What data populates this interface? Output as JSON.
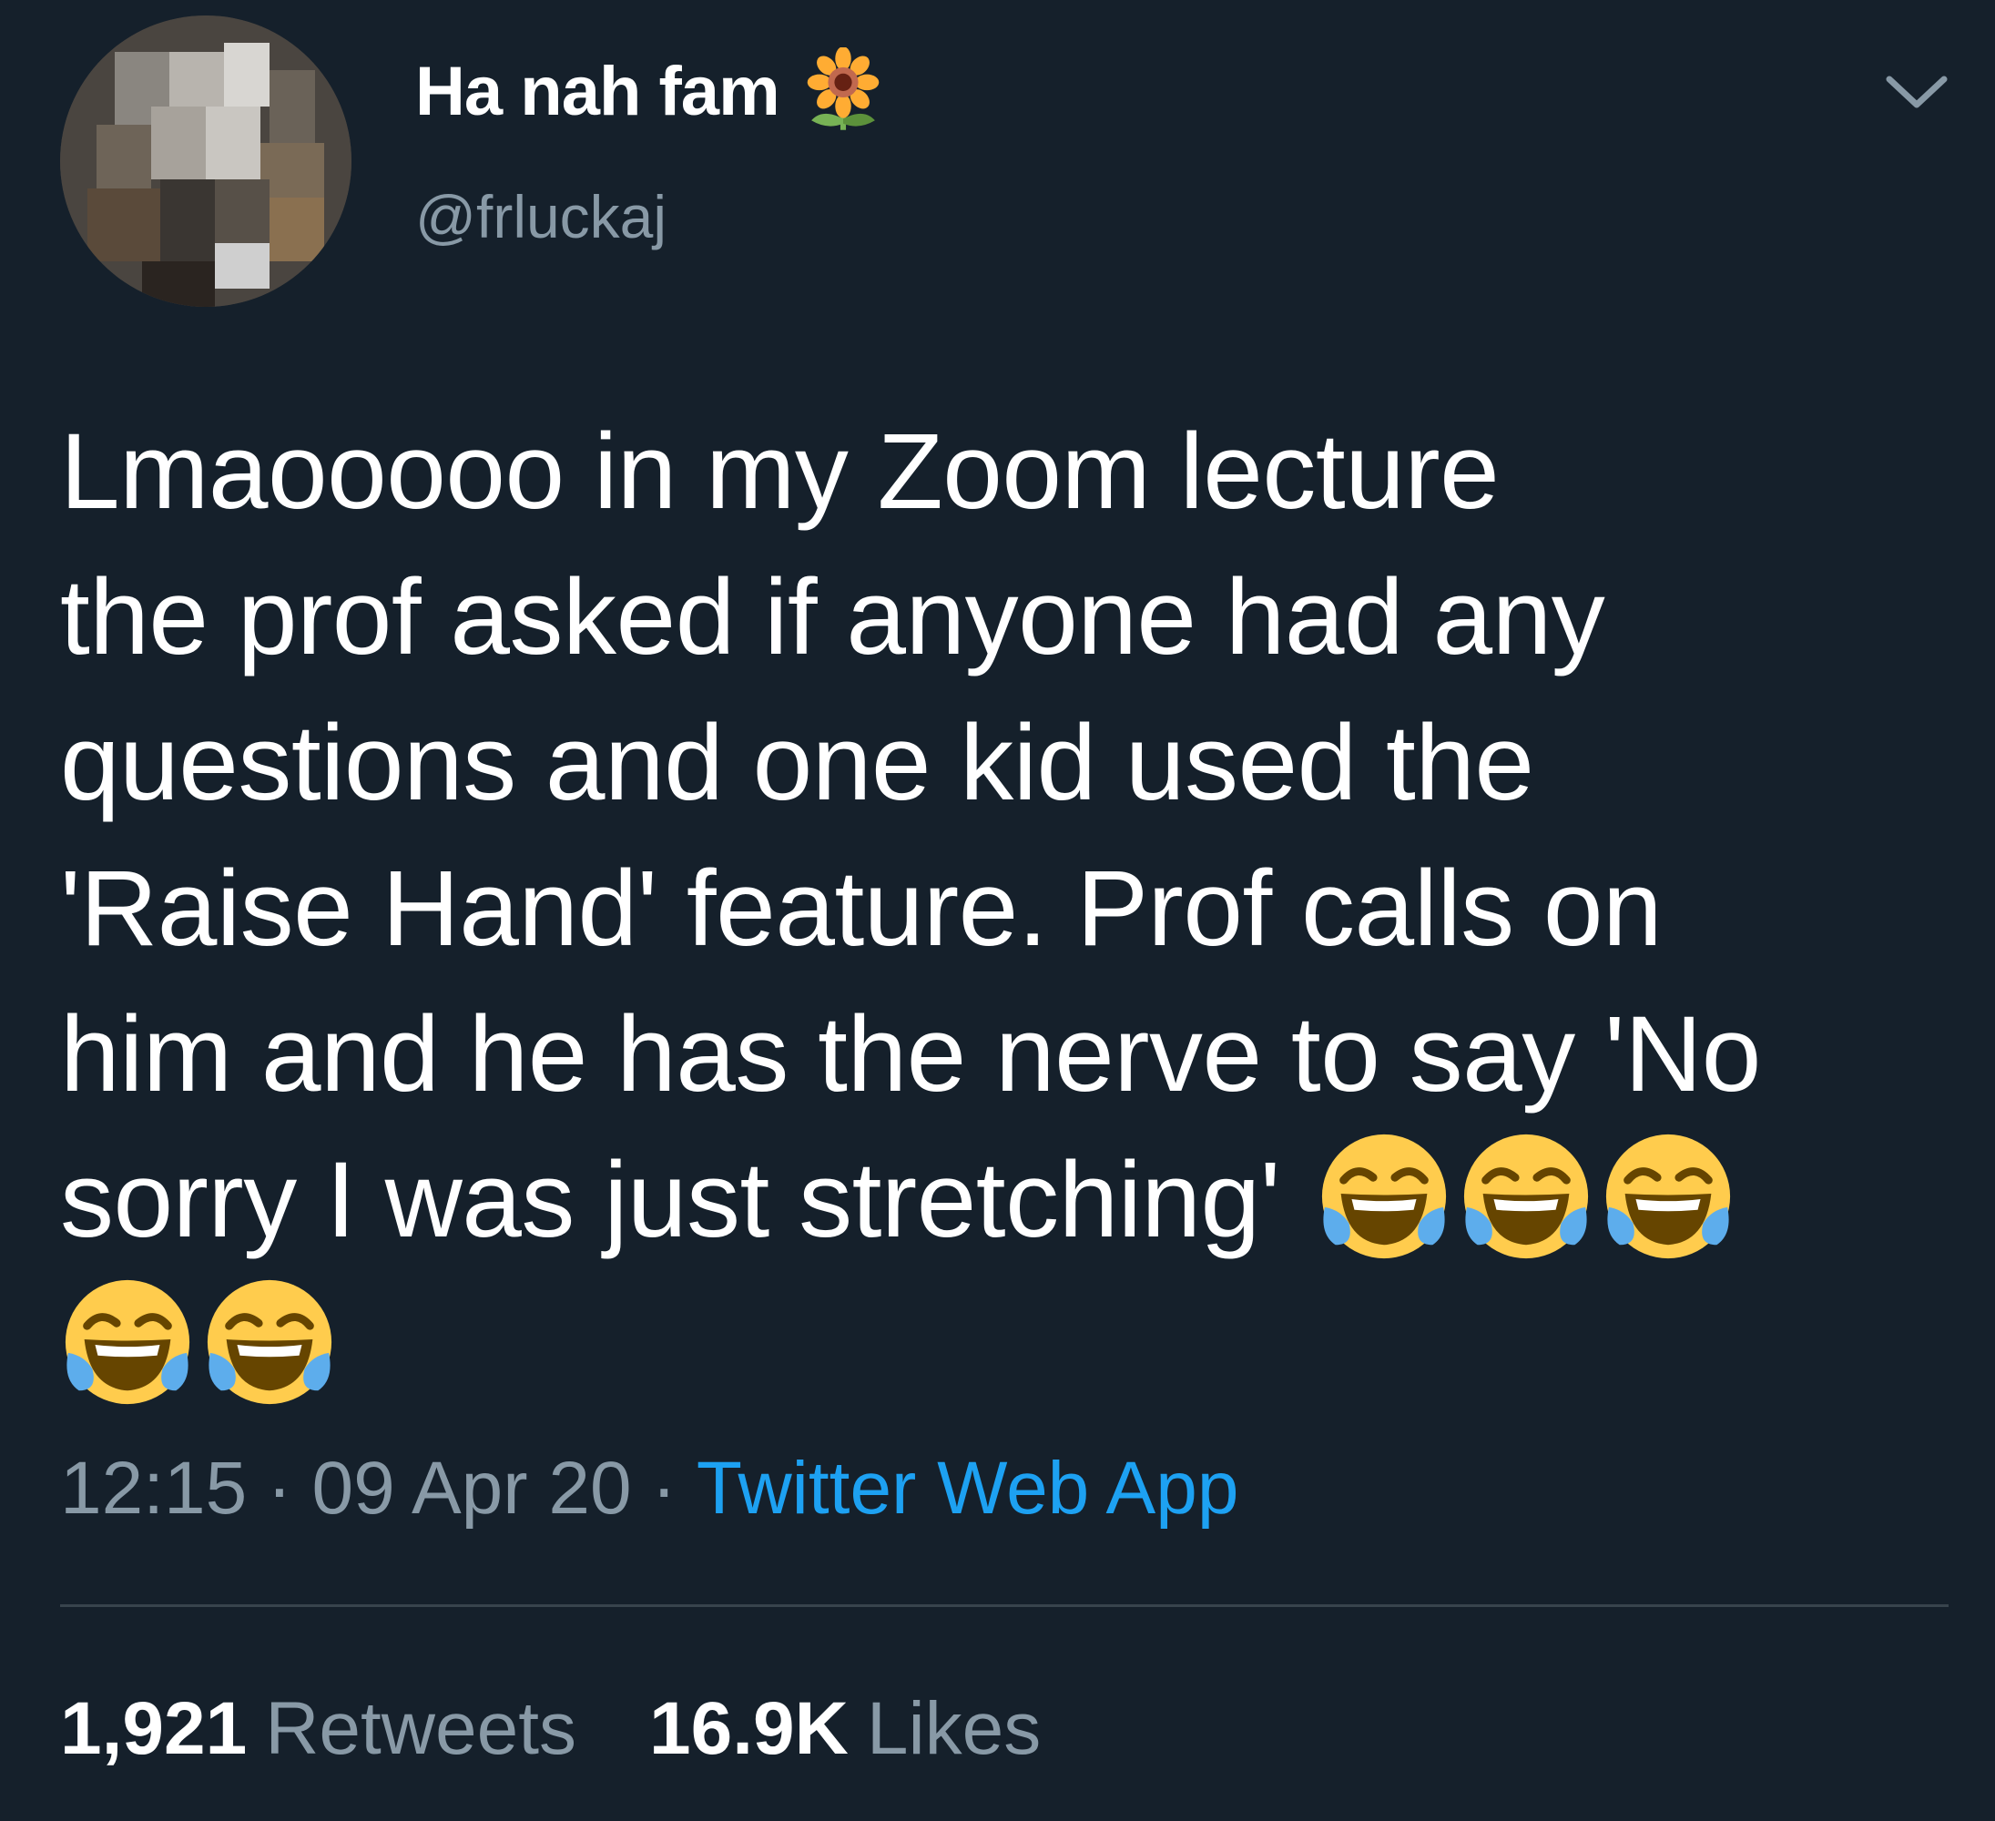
{
  "colors": {
    "background": "#15202b",
    "text_primary": "#ffffff",
    "text_secondary": "#8899a6",
    "link": "#1da1f2",
    "divider": "#38444d"
  },
  "author": {
    "display_name": "Ha nah fam",
    "name_emoji": "sunflower-icon",
    "handle": "@frluckaj",
    "avatar": "blurred-avatar"
  },
  "menu_icon": "chevron-down-icon",
  "tweet": {
    "lines": [
      "Lmaooooo in my Zoom lecture",
      "the prof asked if anyone had any",
      "questions and one kid used the",
      "'Raise Hand' feature. Prof calls on",
      "him and he has the nerve to say 'No",
      "sorry I was just stretching'"
    ],
    "emoji": "face-with-tears-of-joy-icon",
    "emoji_count": 5
  },
  "meta": {
    "time": "12:15",
    "separator": "·",
    "date": "09 Apr 20",
    "source": "Twitter Web App"
  },
  "stats": {
    "retweets_count": "1,921",
    "retweets_label": "Retweets",
    "likes_count": "16.9K",
    "likes_label": "Likes"
  }
}
